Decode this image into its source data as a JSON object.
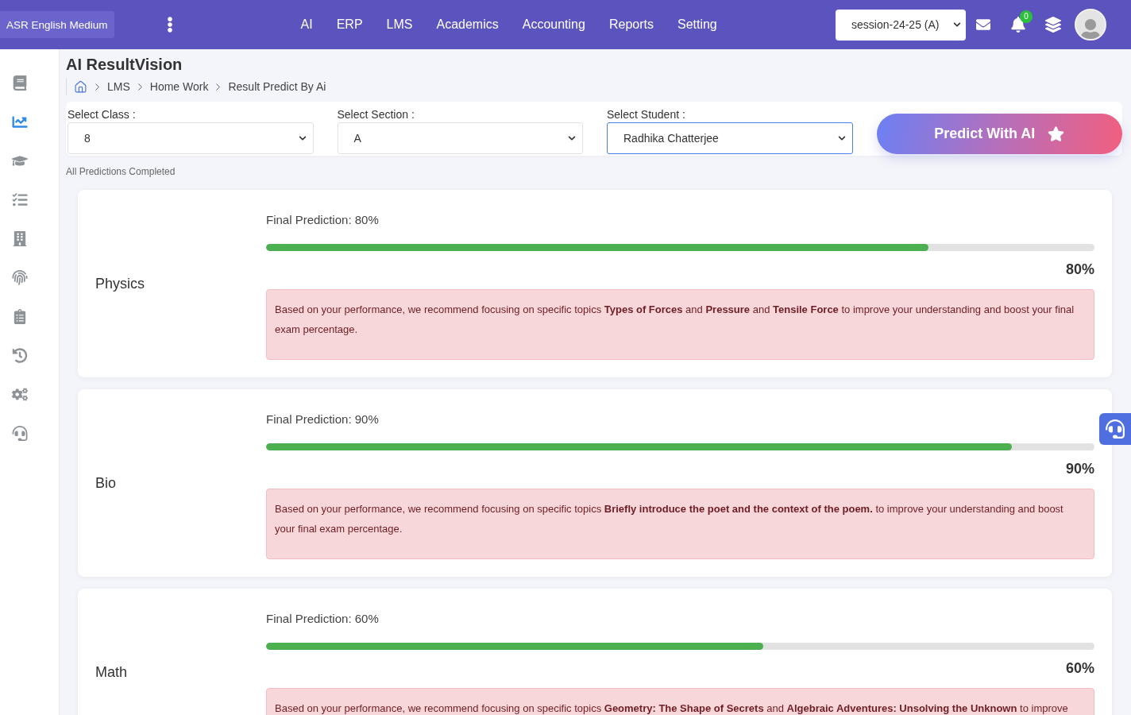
{
  "header": {
    "brand": "ASR English Medium",
    "nav": [
      "AI",
      "ERP",
      "LMS",
      "Academics",
      "Accounting",
      "Reports",
      "Setting"
    ],
    "session": "session-24-25 (A)",
    "notification_count": "0"
  },
  "sidebar": {
    "items": [
      {
        "selected": false
      },
      {
        "selected": true
      },
      {
        "selected": false
      },
      {
        "selected": false
      },
      {
        "selected": false
      },
      {
        "selected": false
      },
      {
        "selected": false
      },
      {
        "selected": false
      },
      {
        "selected": false
      },
      {
        "selected": false
      }
    ]
  },
  "page": {
    "title": "AI ResultVision",
    "breadcrumb": [
      "LMS",
      "Home Work",
      "Result Predict By Ai"
    ]
  },
  "filters": [
    {
      "label": "Select Class :",
      "value": "8",
      "focused": false
    },
    {
      "label": "Select Section :",
      "value": "A",
      "focused": false
    },
    {
      "label": "Select Student :",
      "value": "Radhika Chatterjee",
      "focused": true
    }
  ],
  "predict_button": "Predict With AI",
  "status": "All Predictions Completed",
  "predictions": [
    {
      "subject": "Physics",
      "caption": "Final Prediction: 80%",
      "level": 0.8,
      "reading": "80%",
      "recommendation": "Based on your performance, we recommend focusing on specific topics **Types of Forces** and **Pressure** and **Tensile Force** to improve your understanding and boost your final exam percentage."
    },
    {
      "subject": "Bio",
      "caption": "Final Prediction: 90%",
      "level": 0.9,
      "reading": "90%",
      "recommendation": "Based on your performance, we recommend focusing on specific topics **Briefly introduce the poet and the context of the poem.** to improve your understanding and boost your final exam percentage."
    },
    {
      "subject": "Math",
      "caption": "Final Prediction: 60%",
      "level": 0.6,
      "reading": "60%",
      "recommendation": "Based on your performance, we recommend focusing on specific topics **Geometry: The Shape of Secrets** and **Algebraic Adventures: Unsolving the Unknown** to improve"
    }
  ]
}
